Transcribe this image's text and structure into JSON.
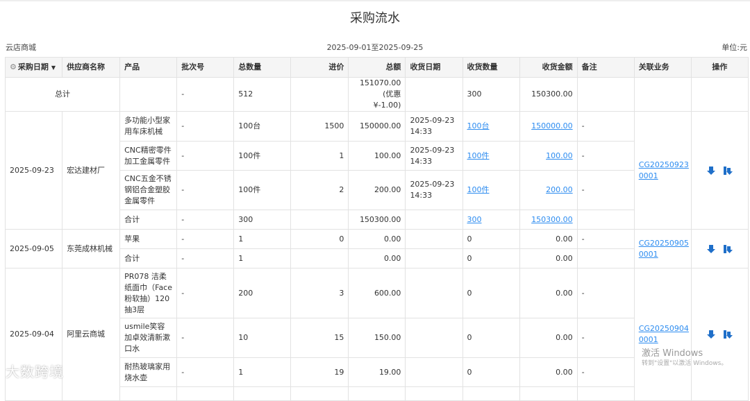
{
  "page": {
    "title": "采购流水",
    "store": "云店商城",
    "date_range": "2025-09-01至2025-09-25",
    "unit": "单位:元"
  },
  "table": {
    "headers": [
      "采购日期",
      "供应商名称",
      "产品",
      "批次号",
      "总数量",
      "进价",
      "总额",
      "收货日期",
      "收货数量",
      "收货金额",
      "备注",
      "关联业务",
      "操作"
    ],
    "summary": {
      "label": "总计",
      "batch": "-",
      "qty": "512",
      "amount": "151070.00",
      "discount": "(优惠 ¥-1.00)",
      "recv_qty": "300",
      "recv_amount": "150300.00"
    },
    "groups": [
      {
        "date": "2025-09-23",
        "supplier": "宏达建材厂",
        "link": "CG20250923\n0001",
        "rows": [
          {
            "product": "多功能小型家用车床机械",
            "batch": "-",
            "qty": "100台",
            "price": "1500",
            "amount": "150000.00",
            "recv_date": "2025-09-23\n14:33",
            "recv_qty": "100台",
            "recv_amount": "150000.00",
            "note": "-"
          },
          {
            "product": "CNC精密零件加工金属零件",
            "batch": "-",
            "qty": "100件",
            "price": "1",
            "amount": "100.00",
            "recv_date": "2025-09-23\n14:33",
            "recv_qty": "100件",
            "recv_amount": "100.00",
            "note": "-"
          },
          {
            "product": "CNC五金不锈钢铝合金塑胶金属零件",
            "batch": "-",
            "qty": "100件",
            "price": "2",
            "amount": "200.00",
            "recv_date": "2025-09-23\n14:33",
            "recv_qty": "100件",
            "recv_amount": "200.00",
            "note": "-"
          }
        ],
        "subtotal": {
          "label": "合计",
          "batch": "-",
          "qty": "300",
          "amount": "150300.00",
          "recv_qty": "300",
          "recv_amount": "150300.00"
        }
      },
      {
        "date": "2025-09-05",
        "supplier": "东莞成林机械",
        "link": "CG20250905\n0001",
        "rows": [
          {
            "product": "苹果",
            "batch": "-",
            "qty": "1",
            "price": "0",
            "amount": "0.00",
            "recv_date": "",
            "recv_qty": "0",
            "recv_amount": "0.00",
            "note": "-"
          }
        ],
        "subtotal": {
          "label": "合计",
          "batch": "-",
          "qty": "1",
          "amount": "0.00",
          "recv_qty": "0",
          "recv_amount": "0.00"
        }
      },
      {
        "date": "2025-09-04",
        "supplier": "阿里云商城",
        "link": "CG20250904\n0001",
        "rows": [
          {
            "product": "PR078 洁柔纸面巾（Face粉软抽）120抽3层",
            "batch": "-",
            "qty": "200",
            "price": "3",
            "amount": "600.00",
            "recv_date": "",
            "recv_qty": "0",
            "recv_amount": "0.00",
            "note": "-"
          },
          {
            "product": "usmile笑容加卓效清新漱口水",
            "batch": "-",
            "qty": "10",
            "price": "15",
            "amount": "150.00",
            "recv_date": "",
            "recv_qty": "0",
            "recv_amount": "0.00",
            "note": "-"
          },
          {
            "product": "耐热玻璃家用烧水壶",
            "batch": "-",
            "qty": "1",
            "price": "19",
            "amount": "19.00",
            "recv_date": "",
            "recv_qty": "0",
            "recv_amount": "0.00",
            "note": "-"
          }
        ]
      }
    ]
  },
  "overlay": {
    "watermark": "大数跨境",
    "win_activate": "激活 Windows",
    "win_hint": "转到\"设置\"以激活 Windows。"
  },
  "icons": {
    "sort": "caret-down-icon",
    "settings": "gear-icon",
    "op1": "download-icon",
    "op2": "export-icon"
  }
}
